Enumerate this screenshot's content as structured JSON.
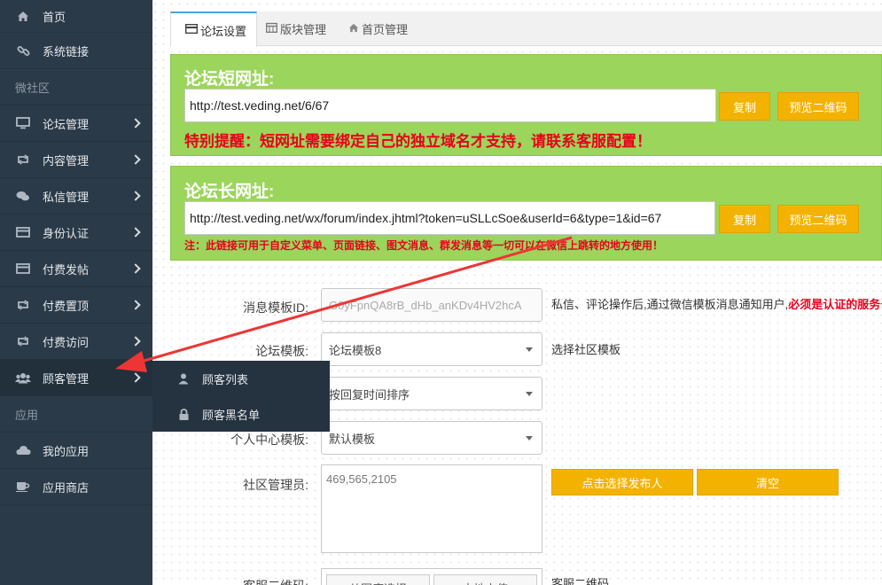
{
  "sidebar": {
    "home": "首页",
    "system_links": "系统链接",
    "section_micro": "微社区",
    "forum_manage": "论坛管理",
    "content_manage": "内容管理",
    "message_manage": "私信管理",
    "identity": "身份认证",
    "paid_post": "付费发帖",
    "paid_top": "付费置顶",
    "paid_visit": "付费访问",
    "customer_manage": "顾客管理",
    "section_apps": "应用",
    "my_apps": "我的应用",
    "app_store": "应用商店"
  },
  "flyout": {
    "customer_list": "顾客列表",
    "blacklist": "顾客黑名单"
  },
  "tabs": {
    "forum_settings": "论坛设置",
    "board_manage": "版块管理",
    "home_manage": "首页管理"
  },
  "short_url": {
    "title": "论坛短网址:",
    "value": "http://test.veding.net/6/67",
    "copy": "复制",
    "preview": "预览二维码",
    "warning": "特别提醒：短网址需要绑定自己的独立域名才支持，请联系客服配置！"
  },
  "long_url": {
    "title": "论坛长网址:",
    "value": "http://test.veding.net/wx/forum/index.jhtml?token=uSLLcSoe&userId=6&type=1&id=67",
    "copy": "复制",
    "preview": "预览二维码",
    "note": "注：此链接可用于自定义菜单、页面链接、图文消息、群发消息等一切可以在微信上跳转的地方使用！"
  },
  "form": {
    "msg_template_label": "消息模板ID:",
    "msg_template_value": "G0yFpnQA8rB_dHb_anKDv4HV2hcA",
    "msg_template_note": "私信、评论操作后,通过微信模板消息通知用户,",
    "msg_template_note_red": "必须是认证的服务号",
    "forum_template_label": "论坛模板:",
    "forum_template_value": "论坛模板8",
    "forum_template_note": "选择社区模板",
    "sort_value": "按回复时间排序",
    "profile_template_label": "个人中心模板:",
    "profile_template_value": "默认模板",
    "admin_label": "社区管理员:",
    "admin_value": "469,565,2105",
    "select_poster_btn": "点击选择发布人",
    "clear_btn": "清空",
    "qrcode_label": "客服二维码:",
    "qrcode_note": "客服二维码",
    "from_library_btn": "从图库选择",
    "local_upload_btn": "本地上传"
  },
  "colors": {
    "sidebar_bg": "#2b3a48",
    "green_panel": "#9bd55b",
    "button_yellow": "#f4b200",
    "warning_red": "#e8001c",
    "arrow_red": "#ee3535"
  }
}
